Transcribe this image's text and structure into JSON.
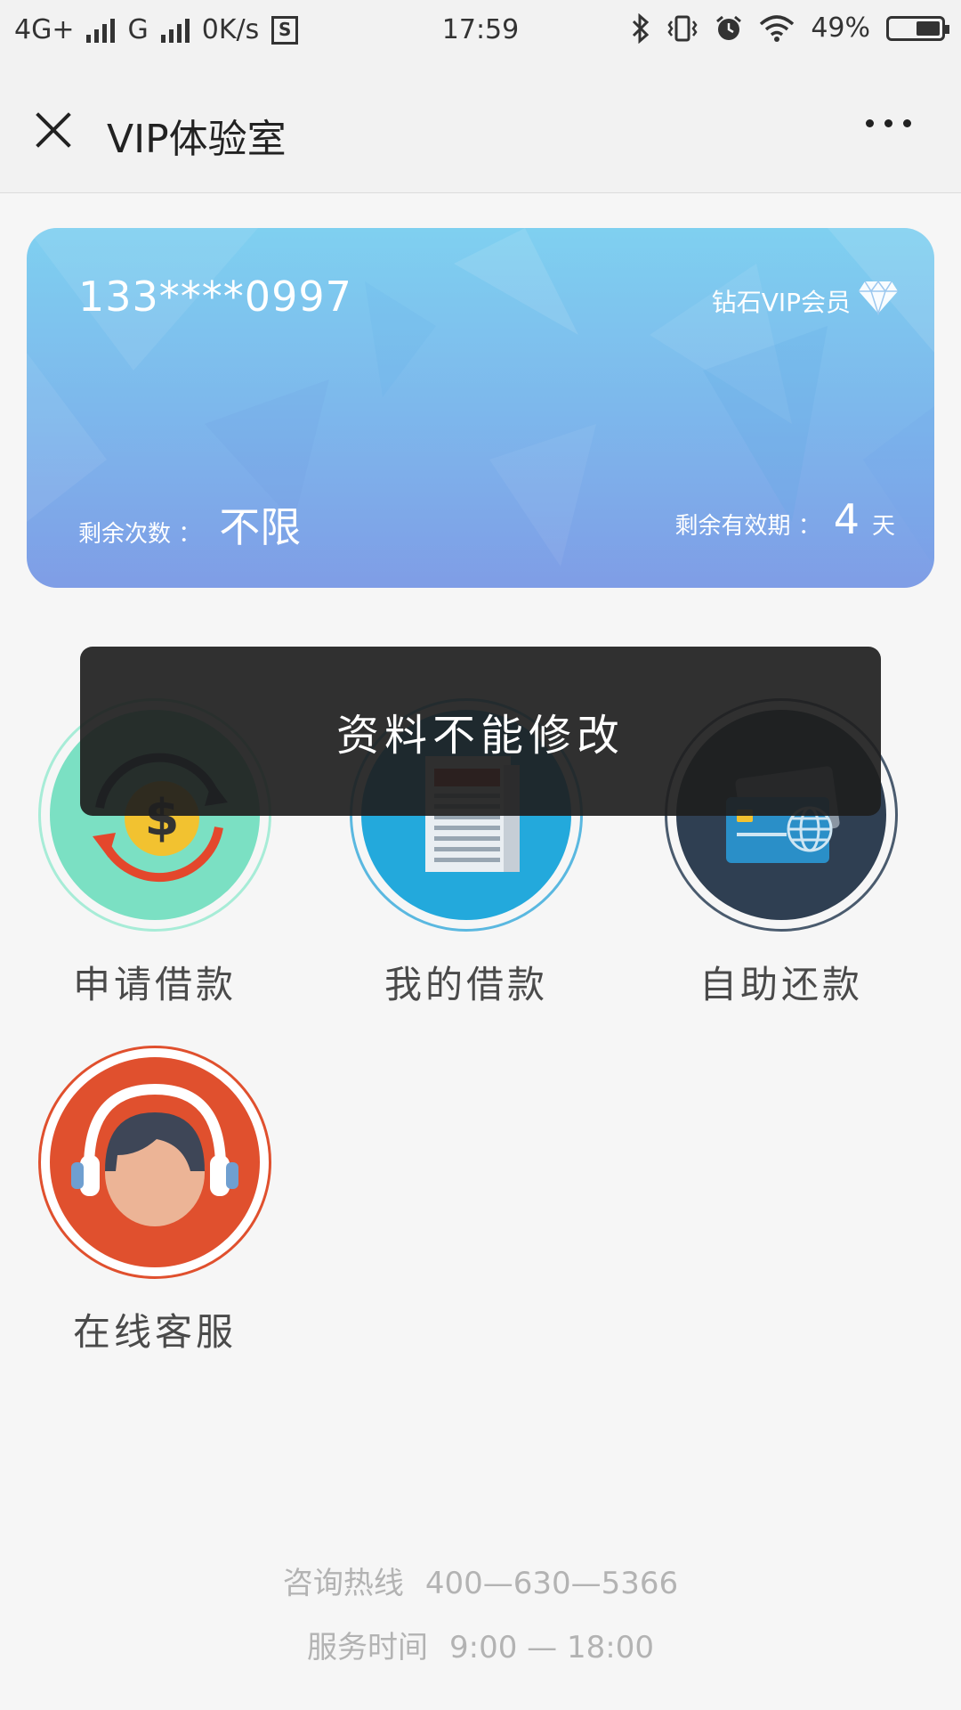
{
  "status_bar": {
    "network_1": "4G+",
    "network_2": "G",
    "speed": "0K/s",
    "s_icon": "S",
    "time": "17:59",
    "battery": "49%",
    "battery_level_percent": 49,
    "icons": [
      "bluetooth-icon",
      "vibrate-icon",
      "alarm-icon",
      "wifi-icon"
    ]
  },
  "nav": {
    "title": "VIP体验室",
    "close_icon": "close-icon",
    "more_icon": "more-icon"
  },
  "vip_card": {
    "phone": "133****0997",
    "level": "钻石VIP会员",
    "level_icon": "diamond-icon",
    "remaining_label": "剩余次数 ：",
    "remaining_value": "不限",
    "expiry_label": "剩余有效期 ：",
    "expiry_value": "4",
    "expiry_unit": "天",
    "gradient_colors": [
      "#7fd0f0",
      "#7f9de6"
    ]
  },
  "menu": [
    {
      "label": "申请借款",
      "icon": "dollar-refresh-icon",
      "color": "#7be0c3"
    },
    {
      "label": "我的借款",
      "icon": "newspaper-icon",
      "color": "#23a9dc"
    },
    {
      "label": "自助还款",
      "icon": "credit-card-globe-icon",
      "color": "#2f3f52"
    },
    {
      "label": "在线客服",
      "icon": "headset-agent-icon",
      "color": "#e0502e"
    }
  ],
  "toast": {
    "message": "资料不能修改"
  },
  "footer": {
    "hotline_label": "咨询热线",
    "hotline_value": "400—630—5366",
    "hours_label": "服务时间",
    "hours_value": "9:00 — 18:00"
  }
}
